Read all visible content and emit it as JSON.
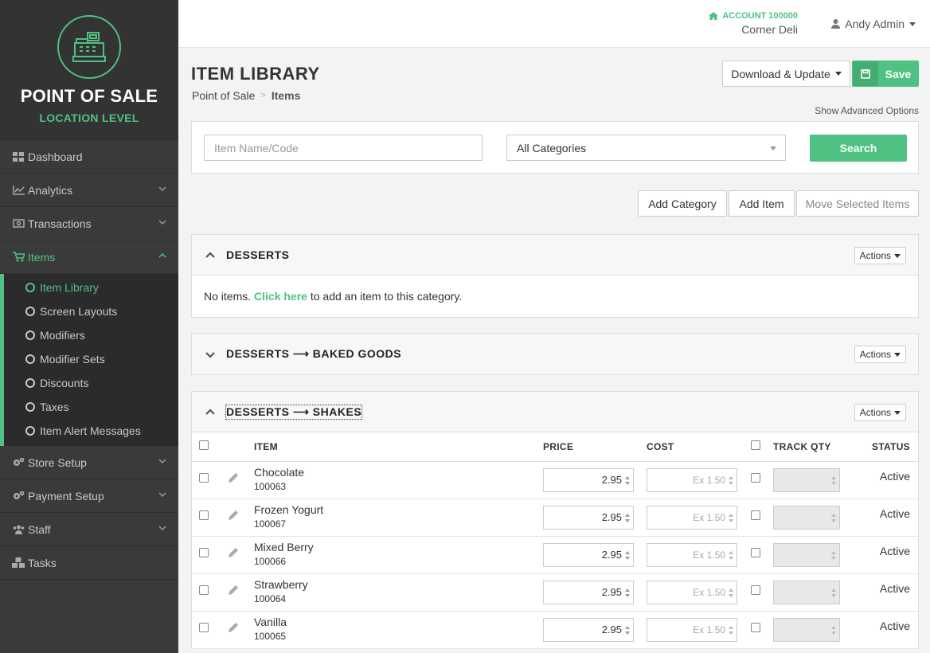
{
  "brand": {
    "title": "POINT OF SALE",
    "subtitle": "LOCATION LEVEL"
  },
  "nav": {
    "dashboard": "Dashboard",
    "analytics": "Analytics",
    "transactions": "Transactions",
    "items": "Items",
    "items_sub": [
      "Item Library",
      "Screen Layouts",
      "Modifiers",
      "Modifier Sets",
      "Discounts",
      "Taxes",
      "Item Alert Messages"
    ],
    "store_setup": "Store Setup",
    "payment_setup": "Payment Setup",
    "staff": "Staff",
    "tasks": "Tasks"
  },
  "topbar": {
    "account_number": "ACCOUNT 100000",
    "account_name": "Corner Deli",
    "user": "Andy Admin"
  },
  "page": {
    "title": "ITEM LIBRARY",
    "breadcrumb": [
      "Point of Sale",
      "Items"
    ],
    "download_label": "Download & Update",
    "save_label": "Save",
    "advanced_label": "Show Advanced Options"
  },
  "search": {
    "name_placeholder": "Item Name/Code",
    "category_value": "All Categories",
    "button": "Search"
  },
  "toolbar": {
    "add_category": "Add Category",
    "add_item": "Add Item",
    "move_items": "Move Selected Items"
  },
  "categories": [
    {
      "title": "DESSERTS",
      "actions": "Actions",
      "empty_prefix": "No items.",
      "empty_link": "Click here",
      "empty_suffix": "to add an item to this category."
    },
    {
      "title": "DESSERTS ⟶ BAKED GOODS",
      "actions": "Actions"
    },
    {
      "title": "DESSERTS ⟶ SHAKES",
      "actions": "Actions"
    }
  ],
  "table": {
    "headers": {
      "item": "ITEM",
      "price": "PRICE",
      "cost": "COST",
      "track": "TRACK QTY",
      "status": "STATUS"
    },
    "rows": [
      {
        "name": "Chocolate",
        "code": "100063",
        "price": "2.95",
        "cost": "Ex 1.50",
        "status": "Active"
      },
      {
        "name": "Frozen Yogurt",
        "code": "100067",
        "price": "2.95",
        "cost": "Ex 1.50",
        "status": "Active"
      },
      {
        "name": "Mixed Berry",
        "code": "100066",
        "price": "2.95",
        "cost": "Ex 1.50",
        "status": "Active"
      },
      {
        "name": "Strawberry",
        "code": "100064",
        "price": "2.95",
        "cost": "Ex 1.50",
        "status": "Active"
      },
      {
        "name": "Vanilla",
        "code": "100065",
        "price": "2.95",
        "cost": "Ex 1.50",
        "status": "Active"
      }
    ]
  },
  "colors": {
    "accent": "#4fc283",
    "sidebar": "#3a3a3a"
  }
}
